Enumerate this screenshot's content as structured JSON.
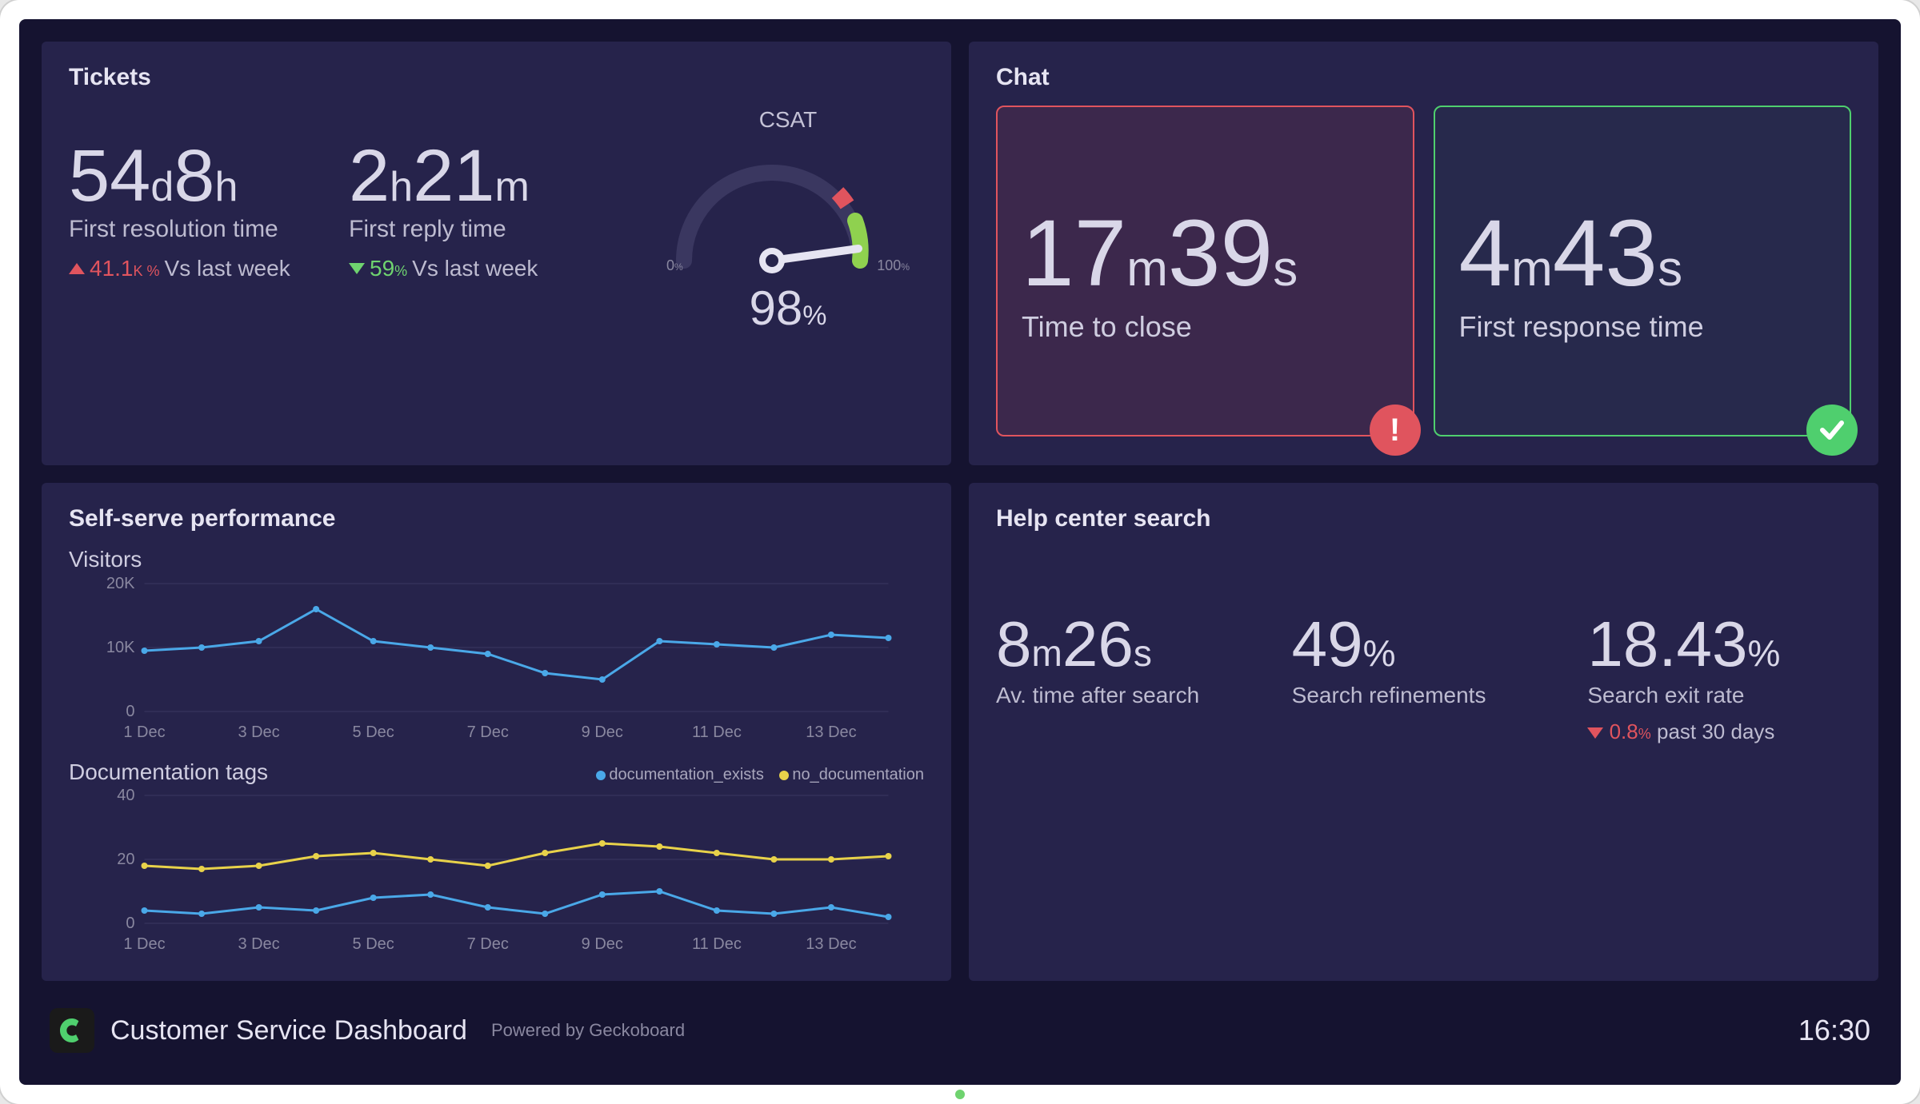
{
  "tickets": {
    "title": "Tickets",
    "first_resolution": {
      "value_parts": [
        "54",
        "d",
        "8",
        "h"
      ],
      "label": "First resolution time",
      "compare_value": "41.1",
      "compare_unit": "K %",
      "compare_text": "Vs last week",
      "direction": "up"
    },
    "first_reply": {
      "value_parts": [
        "2",
        "h",
        "21",
        "m"
      ],
      "label": "First reply time",
      "compare_value": "59",
      "compare_unit": "%",
      "compare_text": "Vs last week",
      "direction": "down"
    },
    "csat": {
      "title": "CSAT",
      "value": "98",
      "unit": "%",
      "min_label": "0",
      "max_label": "100",
      "scale_unit": "%"
    }
  },
  "chat": {
    "title": "Chat",
    "time_to_close": {
      "value_parts": [
        "17",
        "m",
        "39",
        "s"
      ],
      "label": "Time to close",
      "status": "warn"
    },
    "first_response": {
      "value_parts": [
        "4",
        "m",
        "43",
        "s"
      ],
      "label": "First response time",
      "status": "ok"
    }
  },
  "selfserve": {
    "title": "Self-serve performance",
    "visitors_title": "Visitors",
    "doctags_title": "Documentation tags",
    "legend_doc_exists": "documentation_exists",
    "legend_no_doc": "no_documentation"
  },
  "helpcenter": {
    "title": "Help center search",
    "avg_time": {
      "value_parts": [
        "8",
        "m",
        "26",
        "s"
      ],
      "label": "Av. time after search"
    },
    "refinements": {
      "value": "49",
      "unit": "%",
      "label": "Search refinements"
    },
    "exit_rate": {
      "value": "18.43",
      "unit": "%",
      "label": "Search exit rate",
      "compare_value": "0.8",
      "compare_unit": "%",
      "compare_text": "past 30 days",
      "direction": "down-bad"
    }
  },
  "footer": {
    "title": "Customer Service Dashboard",
    "subtitle": "Powered by Geckoboard",
    "time": "16:30"
  },
  "colors": {
    "series_blue": "#4aa8e8",
    "series_yellow": "#e8d24a",
    "accent_green": "#4fcf6e",
    "accent_red": "#e0545e"
  },
  "chart_data": [
    {
      "type": "gauge",
      "title": "CSAT",
      "value": 98,
      "min": 0,
      "max": 100,
      "unit": "%"
    },
    {
      "type": "line",
      "title": "Visitors",
      "ylabel": "",
      "ylim": [
        0,
        20000
      ],
      "yticks": [
        0,
        10000,
        20000
      ],
      "ytick_labels": [
        "0",
        "10K",
        "20K"
      ],
      "categories": [
        "1 Dec",
        "2 Dec",
        "3 Dec",
        "4 Dec",
        "5 Dec",
        "6 Dec",
        "7 Dec",
        "8 Dec",
        "9 Dec",
        "10 Dec",
        "11 Dec",
        "12 Dec",
        "13 Dec",
        "14 Dec"
      ],
      "xtick_labels": [
        "1 Dec",
        "3 Dec",
        "5 Dec",
        "7 Dec",
        "9 Dec",
        "11 Dec",
        "13 Dec"
      ],
      "series": [
        {
          "name": "visitors",
          "color": "#4aa8e8",
          "values": [
            9500,
            10000,
            11000,
            16000,
            11000,
            10000,
            9000,
            6000,
            5000,
            11000,
            10500,
            10000,
            12000,
            11500
          ]
        }
      ]
    },
    {
      "type": "line",
      "title": "Documentation tags",
      "ylabel": "",
      "ylim": [
        0,
        40
      ],
      "yticks": [
        0,
        20,
        40
      ],
      "categories": [
        "1 Dec",
        "2 Dec",
        "3 Dec",
        "4 Dec",
        "5 Dec",
        "6 Dec",
        "7 Dec",
        "8 Dec",
        "9 Dec",
        "10 Dec",
        "11 Dec",
        "12 Dec",
        "13 Dec",
        "14 Dec"
      ],
      "xtick_labels": [
        "1 Dec",
        "3 Dec",
        "5 Dec",
        "7 Dec",
        "9 Dec",
        "11 Dec",
        "13 Dec"
      ],
      "series": [
        {
          "name": "documentation_exists",
          "color": "#4aa8e8",
          "values": [
            4,
            3,
            5,
            4,
            8,
            9,
            5,
            3,
            9,
            10,
            4,
            3,
            5,
            2
          ]
        },
        {
          "name": "no_documentation",
          "color": "#e8d24a",
          "values": [
            18,
            17,
            18,
            21,
            22,
            20,
            18,
            22,
            25,
            24,
            22,
            20,
            20,
            21
          ]
        }
      ]
    }
  ]
}
